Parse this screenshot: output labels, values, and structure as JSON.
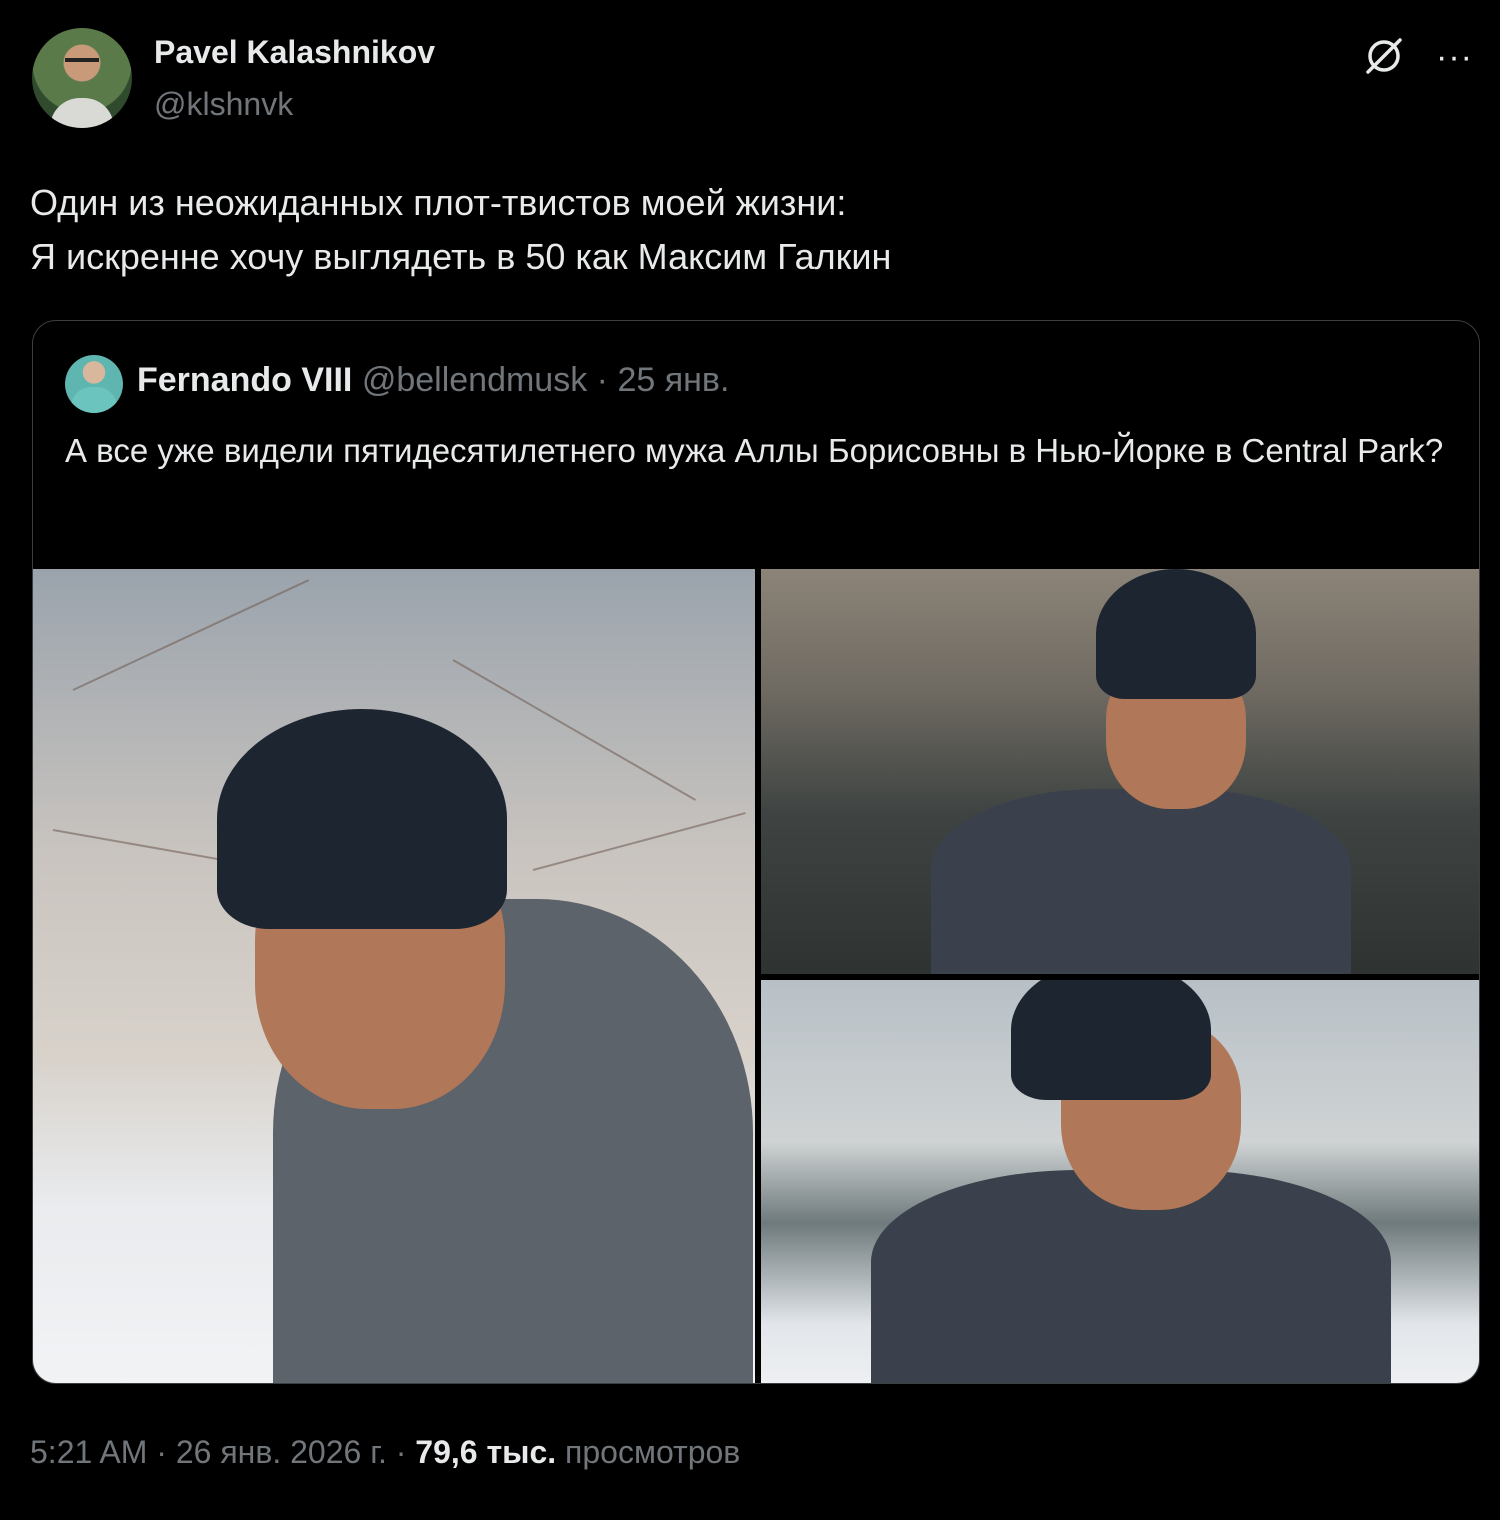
{
  "author": {
    "name": "Pavel Kalashnikov",
    "handle": "@klshnvk"
  },
  "header_icons": {
    "grok": "grok-slash-icon",
    "more": "more-horizontal-icon",
    "more_glyph": "···"
  },
  "tweet": {
    "lines": [
      "Один из неожиданных плот-твистов моей жизни:",
      "Я искренне хочу выглядеть в 50 как Максим Галкин"
    ]
  },
  "quoted": {
    "name": "Fernando VIII",
    "handle": "@bellendmusk",
    "separator": " · ",
    "date": "25 янв.",
    "text": "А все уже видели пятидесятилетнего мужа Аллы Борисовны в Нью-Йорке в Central Park?"
  },
  "footer": {
    "time": "5:21 AM",
    "sep1": " · ",
    "date": "26 янв. 2026 г.",
    "sep2": " · ",
    "views_count": "79,6 тыс.",
    "views_label": " просмотров"
  },
  "colors": {
    "background": "#000000",
    "text": "#e7e9ea",
    "secondary": "#71767b",
    "border": "#3b3f42"
  }
}
